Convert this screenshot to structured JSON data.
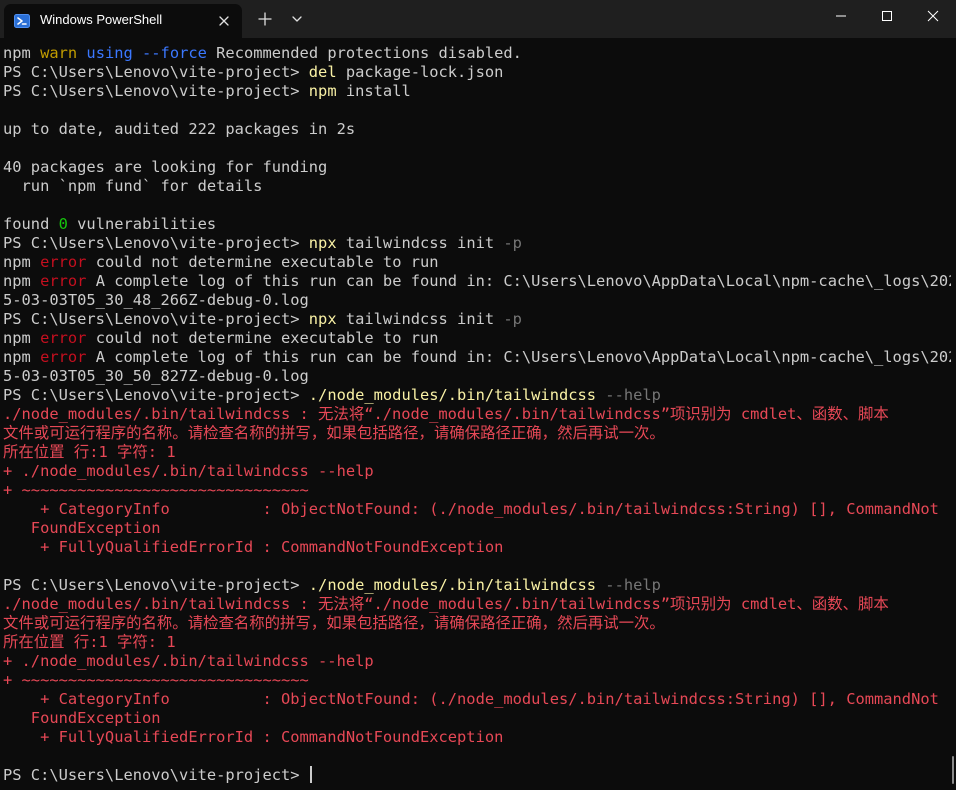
{
  "window": {
    "tab_title": "Windows PowerShell",
    "icons": {
      "tab": "powershell-icon",
      "tab_close": "close-icon",
      "new_tab": "plus-icon",
      "dropdown": "chevron-down-icon",
      "minimize": "minimize-icon",
      "maximize": "maximize-icon",
      "close": "close-icon"
    }
  },
  "colors": {
    "background": "#0c0c0c",
    "titlebar": "#1f1f1f",
    "text": "#cccccc",
    "command": "#f9f1a5",
    "parameter": "#767676",
    "warn": "#c19c00",
    "error_word": "#c50f1f",
    "error_text": "#e74856",
    "keyword_blue": "#3b78ff",
    "number_green": "#16c60c"
  },
  "terminal": {
    "lines": [
      [
        [
          "npm ",
          "default"
        ],
        [
          "warn ",
          "warn"
        ],
        [
          "using --force",
          "blue"
        ],
        [
          " Recommended protections disabled.",
          "default"
        ]
      ],
      [
        [
          "PS C:\\Users\\Lenovo\\vite-project> ",
          "default"
        ],
        [
          "del",
          "cmd"
        ],
        [
          " package-lock.json",
          "default"
        ]
      ],
      [
        [
          "PS C:\\Users\\Lenovo\\vite-project> ",
          "default"
        ],
        [
          "npm",
          "cmd"
        ],
        [
          " install",
          "default"
        ]
      ],
      [],
      [
        [
          "up to date, audited 222 packages in 2s",
          "default"
        ]
      ],
      [],
      [
        [
          "40 packages are looking for funding",
          "default"
        ]
      ],
      [
        [
          "  run `npm fund` for details",
          "default"
        ]
      ],
      [],
      [
        [
          "found ",
          "default"
        ],
        [
          "0",
          "green"
        ],
        [
          " vulnerabilities",
          "default"
        ]
      ],
      [
        [
          "PS C:\\Users\\Lenovo\\vite-project> ",
          "default"
        ],
        [
          "npx",
          "cmd"
        ],
        [
          " tailwindcss init ",
          "default"
        ],
        [
          "-p",
          "param"
        ]
      ],
      [
        [
          "npm ",
          "default"
        ],
        [
          "error",
          "error"
        ],
        [
          " could not determine executable to run",
          "default"
        ]
      ],
      [
        [
          "npm ",
          "default"
        ],
        [
          "error",
          "error"
        ],
        [
          " A complete log of this run can be found in: C:\\Users\\Lenovo\\AppData\\Local\\npm-cache\\_logs\\202",
          "default"
        ]
      ],
      [
        [
          "5-03-03T05_30_48_266Z-debug-0.log",
          "default"
        ]
      ],
      [
        [
          "PS C:\\Users\\Lenovo\\vite-project> ",
          "default"
        ],
        [
          "npx",
          "cmd"
        ],
        [
          " tailwindcss init ",
          "default"
        ],
        [
          "-p",
          "param"
        ]
      ],
      [
        [
          "npm ",
          "default"
        ],
        [
          "error",
          "error"
        ],
        [
          " could not determine executable to run",
          "default"
        ]
      ],
      [
        [
          "npm ",
          "default"
        ],
        [
          "error",
          "error"
        ],
        [
          " A complete log of this run can be found in: C:\\Users\\Lenovo\\AppData\\Local\\npm-cache\\_logs\\202",
          "default"
        ]
      ],
      [
        [
          "5-03-03T05_30_50_827Z-debug-0.log",
          "default"
        ]
      ],
      [
        [
          "PS C:\\Users\\Lenovo\\vite-project> ",
          "default"
        ],
        [
          "./node_modules/.bin/tailwindcss",
          "cmd"
        ],
        [
          " --help",
          "param"
        ]
      ],
      [
        [
          "./node_modules/.bin/tailwindcss : 无法将“./node_modules/.bin/tailwindcss”项识别为 cmdlet、函数、脚本",
          "red"
        ]
      ],
      [
        [
          "文件或可运行程序的名称。请检查名称的拼写，如果包括路径，请确保路径正确，然后再试一次。",
          "red"
        ]
      ],
      [
        [
          "所在位置 行:1 字符: 1",
          "red"
        ]
      ],
      [
        [
          "+ ./node_modules/.bin/tailwindcss --help",
          "red"
        ]
      ],
      [
        [
          "+ ~~~~~~~~~~~~~~~~~~~~~~~~~~~~~~~",
          "red"
        ]
      ],
      [
        [
          "    + CategoryInfo          : ObjectNotFound: (./node_modules/.bin/tailwindcss:String) [], CommandNot",
          "red"
        ]
      ],
      [
        [
          "   FoundException",
          "red"
        ]
      ],
      [
        [
          "    + FullyQualifiedErrorId : CommandNotFoundException",
          "red"
        ]
      ],
      [],
      [
        [
          "PS C:\\Users\\Lenovo\\vite-project> ",
          "default"
        ],
        [
          "./node_modules/.bin/tailwindcss",
          "cmd"
        ],
        [
          " --help",
          "param"
        ]
      ],
      [
        [
          "./node_modules/.bin/tailwindcss : 无法将“./node_modules/.bin/tailwindcss”项识别为 cmdlet、函数、脚本",
          "red"
        ]
      ],
      [
        [
          "文件或可运行程序的名称。请检查名称的拼写，如果包括路径，请确保路径正确，然后再试一次。",
          "red"
        ]
      ],
      [
        [
          "所在位置 行:1 字符: 1",
          "red"
        ]
      ],
      [
        [
          "+ ./node_modules/.bin/tailwindcss --help",
          "red"
        ]
      ],
      [
        [
          "+ ~~~~~~~~~~~~~~~~~~~~~~~~~~~~~~~",
          "red"
        ]
      ],
      [
        [
          "    + CategoryInfo          : ObjectNotFound: (./node_modules/.bin/tailwindcss:String) [], CommandNot",
          "red"
        ]
      ],
      [
        [
          "   FoundException",
          "red"
        ]
      ],
      [
        [
          "    + FullyQualifiedErrorId : CommandNotFoundException",
          "red"
        ]
      ],
      [],
      [
        [
          "PS C:\\Users\\Lenovo\\vite-project> ",
          "default"
        ]
      ]
    ]
  }
}
